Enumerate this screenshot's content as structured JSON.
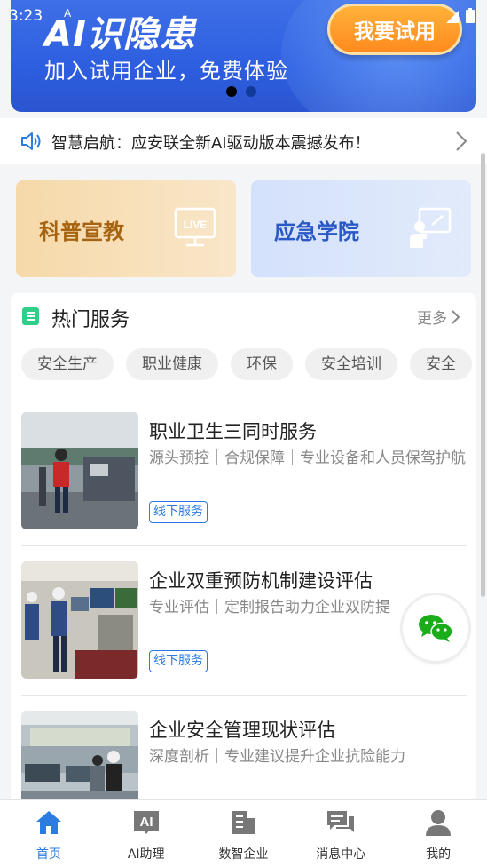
{
  "status_bar": {
    "time": "3:23",
    "mini": "A"
  },
  "banner": {
    "title": "AI识隐患",
    "subtitle": "加入试用企业，免费体验",
    "cta": "我要试用",
    "pages": 2,
    "active_page": 1
  },
  "notice": {
    "text": "智慧启航：应安联全新AI驱动版本震撼发布！"
  },
  "promo_cards": [
    {
      "label": "科普宣教",
      "icon": "tv-live-icon"
    },
    {
      "label": "应急学院",
      "icon": "teacher-board-icon"
    }
  ],
  "hot_services": {
    "title": "热门服务",
    "more": "更多",
    "chips": [
      "安全生产",
      "职业健康",
      "环保",
      "安全培训",
      "安全"
    ],
    "items": [
      {
        "name": "职业卫生三同时服务",
        "desc": "源头预控｜合规保障｜专业设备和人员保驾护航",
        "tag": "线下服务"
      },
      {
        "name": "企业双重预防机制建设评估",
        "desc": "专业评估｜定制报告助力企业双防提",
        "tag": "线下服务"
      },
      {
        "name": "企业安全管理现状评估",
        "desc": "深度剖析｜专业建议提升企业抗险能力",
        "tag": ""
      }
    ]
  },
  "tabbar": {
    "items": [
      {
        "label": "首页",
        "icon": "home-icon",
        "active": true
      },
      {
        "label": "AI助理",
        "icon": "ai-icon",
        "active": false
      },
      {
        "label": "数智企业",
        "icon": "building-icon",
        "active": false
      },
      {
        "label": "消息中心",
        "icon": "message-icon",
        "active": false
      },
      {
        "label": "我的",
        "icon": "user-icon",
        "active": false
      }
    ]
  },
  "colors": {
    "accent": "#2b7be0",
    "banner": "#2d5ee0",
    "cta": "#ff9a2a"
  }
}
